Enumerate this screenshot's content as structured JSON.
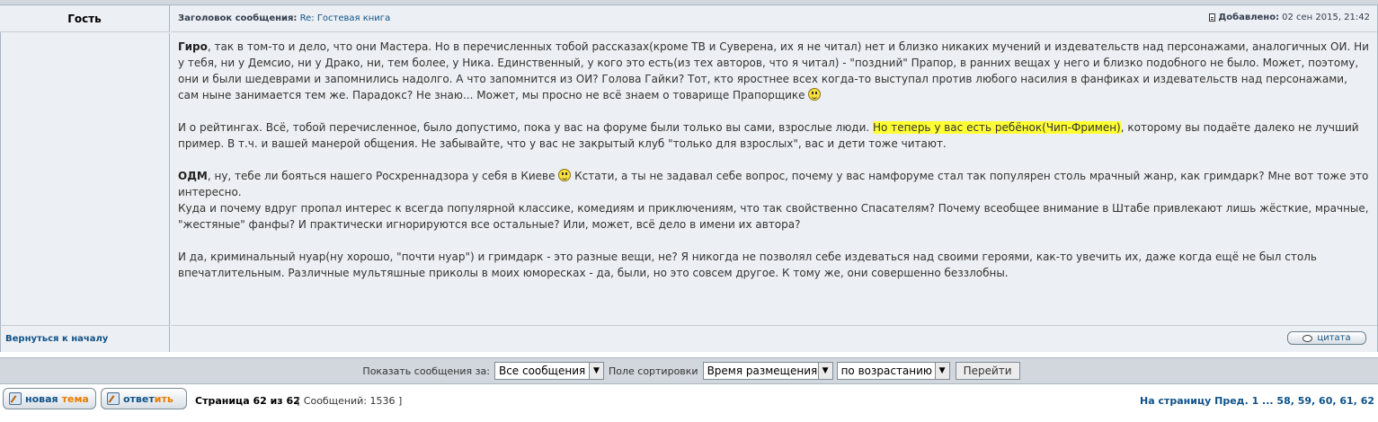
{
  "post": {
    "author": "Гость",
    "subject_label": "Заголовок сообщения:",
    "subject": "Re: Гостевая книга",
    "added_label": "Добавлено:",
    "added_date": "02 сен 2015, 21:42",
    "p1": {
      "name": "Гиро",
      "line1": ", так в том-то и дело, что они Мастера. Но в перечисленных тобой рассказах(кроме ТВ и Суверена, их я не читал) нет и близко никаких мучений и издевательств над персонажами, аналогичных ОИ. Ни у тебя, ни у Демсио, ни у Драко, ни, тем более, у Ника. Единственный, у кого это есть(из тех авторов, что я читал) - \"поздний\" Прапор, в ранних вещах у него и близко подобного не было. Может, поэтому, они и были шедеврами и запомнились надолго. А что запомнится из ОИ? Голова Гайки? Тот, кто яростнее всех когда-то выступал против любого насилия в фанфиках и издевательств над персонажами, сам ныне занимается тем же. Парадокс? Не знаю... Может, мы просно не всё знаем о товарище Прапорщике "
    },
    "p2": {
      "before": "И о рейтингах. Всё, тобой перечисленное, было допустимо, пока у вас на форуме были только вы сами, взрослые люди. ",
      "highlight": "Но теперь у вас есть ребёнок(Чип-Фримен)",
      "after": ", которому вы подаёте далеко не лучший пример. В т.ч. и вашей манерой общения. Не забывайте, что у вас не закрытый клуб \"только для взрослых\", вас и дети тоже читают."
    },
    "p3": {
      "name": "ОДМ",
      "line1": ", ну, тебе ли бояться нашего Росхреннадзора у себя в Киеве ",
      "line1b": " Кстати, а ты не задавал себе вопрос, почему у вас намфоруме стал так популярен столь мрачный жанр, как гримдарк? Мне вот тоже это интересно.",
      "line2": "Куда и почему вдруг пропал интерес к всегда популярной классике, комедиям и приключениям, что так свойственно Спасателям? Почему всеобщее внимание в Штабе привлекают лишь жёсткие, мрачные, \"жестяные\" фанфы? И практически игнорируются все остальные? Или, может, всё дело в имени их автора?"
    },
    "p4": "И да, криминальный нуар(ну хорошо, \"почти нуар\") и гримдарк - это разные вещи, не? Я никогда не позволял себе издеваться над своими героями, как-то увечить их, даже когда ещё не был столь впечатлительным. Различные мультяшные приколы в моих юморесках - да, были, но это совсем другое. К тому же, они совершенно беззлобны.",
    "back_to_top": "Вернуться к началу",
    "quote_label": "цитата"
  },
  "sortbar": {
    "show_label": "Показать сообщения за:",
    "show_value": "Все сообщения",
    "sort_label": "Поле сортировки",
    "sort_value": "Время размещения",
    "order_value": "по возрастанию",
    "go_label": "Перейти"
  },
  "bottom": {
    "new_topic_a": "новая",
    "new_topic_b": "тема",
    "reply_a": "ответ",
    "reply_b": "ить",
    "page_info": "Страница 62 из 62",
    "count_info": "[ Сообщений: 1536 ]",
    "pager": "На страницу Пред.  1 ... 58, 59, 60, 61, 62"
  }
}
